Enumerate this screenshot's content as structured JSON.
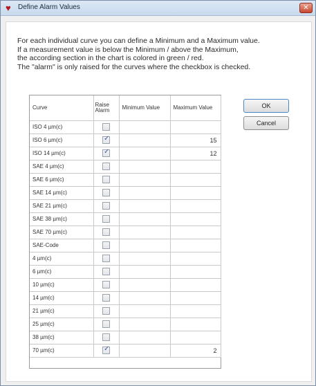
{
  "window": {
    "title": "Define Alarm Values"
  },
  "instructions": [
    "For each individual curve you can define a Minimum and a Maximum value.",
    "If a measurement value is below the Minimum / above the Maximum,",
    "the according section in the chart is colored in green / red.",
    "The \"alarm\" is only raised for the curves where the checkbox is checked."
  ],
  "table": {
    "headers": {
      "curve": "Curve",
      "raise": "Raise Alarm",
      "min": "Minimum Value",
      "max": "Maximum Value"
    },
    "rows": [
      {
        "curve": "ISO  4 µm(c)",
        "checked": false,
        "min": "",
        "max": ""
      },
      {
        "curve": "ISO  6 µm(c)",
        "checked": true,
        "min": "",
        "max": "15"
      },
      {
        "curve": "ISO 14 µm(c)",
        "checked": true,
        "min": "",
        "max": "12"
      },
      {
        "curve": "SAE  4 µm(c)",
        "checked": false,
        "min": "",
        "max": ""
      },
      {
        "curve": "SAE  6 µm(c)",
        "checked": false,
        "min": "",
        "max": ""
      },
      {
        "curve": "SAE 14 µm(c)",
        "checked": false,
        "min": "",
        "max": ""
      },
      {
        "curve": "SAE 21 µm(c)",
        "checked": false,
        "min": "",
        "max": ""
      },
      {
        "curve": "SAE 38 µm(c)",
        "checked": false,
        "min": "",
        "max": ""
      },
      {
        "curve": "SAE 70 µm(c)",
        "checked": false,
        "min": "",
        "max": ""
      },
      {
        "curve": "SAE-Code",
        "checked": false,
        "min": "",
        "max": ""
      },
      {
        "curve": "4 µm(c)",
        "checked": false,
        "min": "",
        "max": ""
      },
      {
        "curve": "6 µm(c)",
        "checked": false,
        "min": "",
        "max": ""
      },
      {
        "curve": "10 µm(c)",
        "checked": false,
        "min": "",
        "max": ""
      },
      {
        "curve": "14 µm(c)",
        "checked": false,
        "min": "",
        "max": ""
      },
      {
        "curve": "21 µm(c)",
        "checked": false,
        "min": "",
        "max": ""
      },
      {
        "curve": "25 µm(c)",
        "checked": false,
        "min": "",
        "max": ""
      },
      {
        "curve": "38 µm(c)",
        "checked": false,
        "min": "",
        "max": ""
      },
      {
        "curve": "70 µm(c)",
        "checked": true,
        "min": "",
        "max": "2"
      }
    ]
  },
  "buttons": {
    "ok": "OK",
    "cancel": "Cancel"
  }
}
